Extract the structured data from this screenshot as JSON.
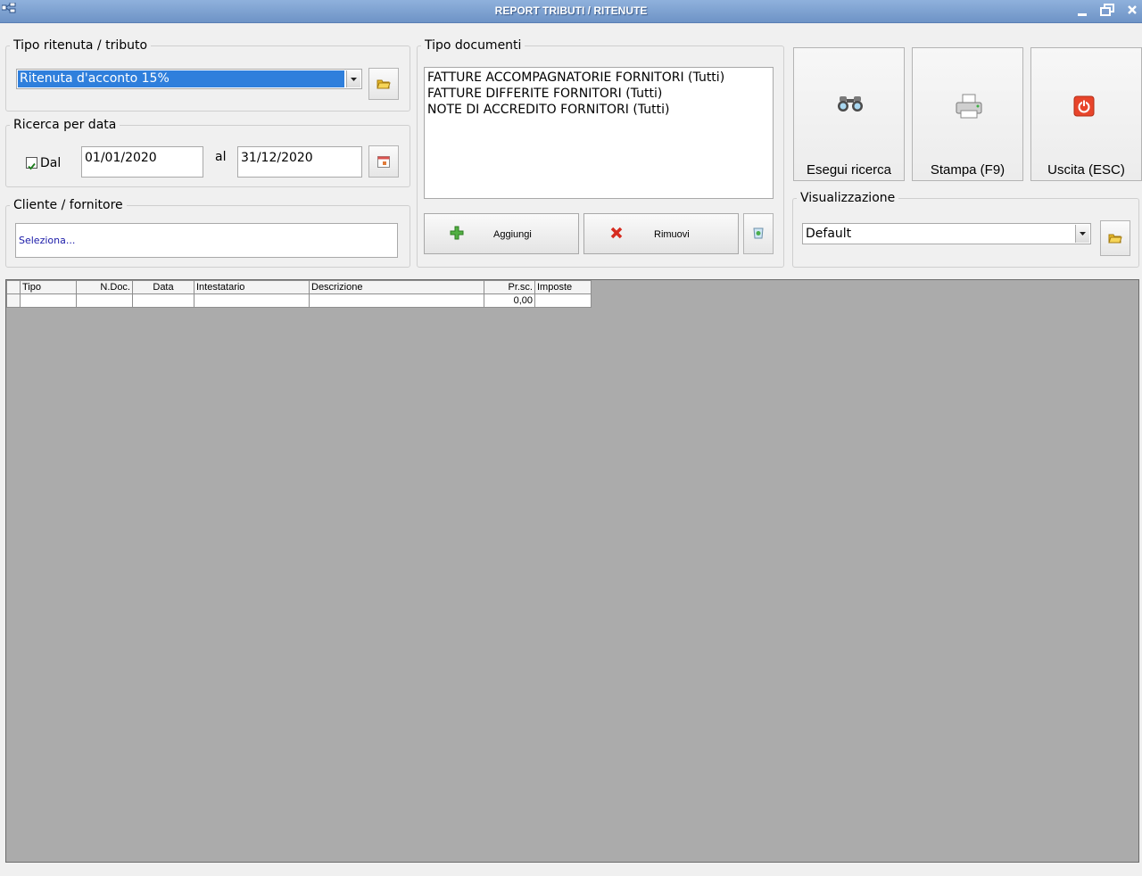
{
  "window": {
    "title": "REPORT TRIBUTI / RITENUTE"
  },
  "tipo_ritenuta": {
    "legend": "Tipo ritenuta / tributo",
    "selected": "Ritenuta d'acconto 15%"
  },
  "ricerca_data": {
    "legend": "Ricerca per data",
    "dal_label": "Dal",
    "dal_checked": true,
    "date_from": "01/01/2020",
    "al_label": "al",
    "date_to": "31/12/2020"
  },
  "cliente": {
    "legend": "Cliente / fornitore",
    "placeholder": "Seleziona..."
  },
  "tipo_documenti": {
    "legend": "Tipo documenti",
    "items": [
      "FATTURE ACCOMPAGNATORIE FORNITORI (Tutti)",
      "FATTURE DIFFERITE FORNITORI (Tutti)",
      "NOTE DI ACCREDITO FORNITORI (Tutti)"
    ],
    "add_label": "Aggiungi",
    "remove_label": "Rimuovi"
  },
  "actions": {
    "search_label": "Esegui ricerca",
    "print_label": "Stampa (F9)",
    "exit_label": "Uscita (ESC)"
  },
  "visualizzazione": {
    "legend": "Visualizzazione",
    "selected": "Default"
  },
  "grid": {
    "columns": [
      "Tipo",
      "N.Doc.",
      "Data",
      "Intestatario",
      "Descrizione",
      "Pr.sc.",
      "Imposte"
    ],
    "rows": [
      [
        "",
        "",
        "",
        "",
        "",
        "0,00",
        ""
      ]
    ]
  }
}
